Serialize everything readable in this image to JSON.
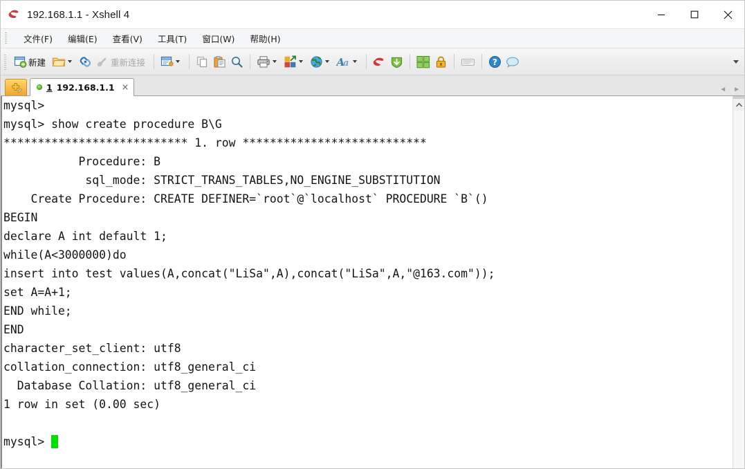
{
  "window": {
    "title": "192.168.1.1 - Xshell 4",
    "app_icon": "xshell-logo-icon",
    "controls": {
      "minimize": "minimize-icon",
      "maximize": "maximize-icon",
      "close": "close-icon"
    }
  },
  "menubar": {
    "items": [
      {
        "label": "文件(F)",
        "name": "menu-file"
      },
      {
        "label": "编辑(E)",
        "name": "menu-edit"
      },
      {
        "label": "查看(V)",
        "name": "menu-view"
      },
      {
        "label": "工具(T)",
        "name": "menu-tools"
      },
      {
        "label": "窗口(W)",
        "name": "menu-window"
      },
      {
        "label": "帮助(H)",
        "name": "menu-help"
      }
    ]
  },
  "toolbar": {
    "new_label": "新建",
    "reconnect_label": "重新连接",
    "overflow": "toolbar-overflow-chevron"
  },
  "tabbar": {
    "new_tab": "new-tab-button",
    "tab": {
      "number": "1",
      "title": "192.168.1.1",
      "close": "×",
      "status": "connected"
    },
    "nav_prev": "◄",
    "nav_next": "►"
  },
  "terminal": {
    "lines": [
      "mysql>",
      "mysql> show create procedure B\\G",
      "*************************** 1. row ***************************",
      "           Procedure: B",
      "            sql_mode: STRICT_TRANS_TABLES,NO_ENGINE_SUBSTITUTION",
      "    Create Procedure: CREATE DEFINER=`root`@`localhost` PROCEDURE `B`()",
      "BEGIN",
      "declare A int default 1;",
      "while(A<3000000)do",
      "insert into test values(A,concat(\"LiSa\",A),concat(\"LiSa\",A,\"@163.com\"));",
      "set A=A+1;",
      "END while;",
      "END",
      "character_set_client: utf8",
      "collation_connection: utf8_general_ci",
      "  Database Collation: utf8_general_ci",
      "1 row in set (0.00 sec)",
      "",
      "mysql> "
    ],
    "prompt_text": "mysql> ",
    "cursor_color": "#00e000",
    "text_color": "#141414",
    "background": "#ffffff"
  }
}
